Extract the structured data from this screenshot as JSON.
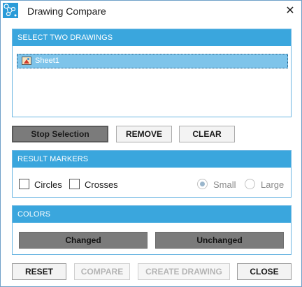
{
  "window": {
    "title": "Drawing Compare",
    "close_symbol": "✕",
    "icon": "app-network-icon"
  },
  "drawings": {
    "header": "SELECT TWO DRAWINGS",
    "items": [
      {
        "label": "Sheet1",
        "icon": "sheet-icon",
        "selected": true
      }
    ]
  },
  "list_actions": {
    "stop_selection": "Stop Selection",
    "remove": "REMOVE",
    "clear": "CLEAR"
  },
  "result_markers": {
    "header": "RESULT MARKERS",
    "circles_label": "Circles",
    "crosses_label": "Crosses",
    "small_label": "Small",
    "large_label": "Large",
    "circles_checked": false,
    "crosses_checked": false,
    "selected_size": "Small"
  },
  "colors": {
    "header": "COLORS",
    "changed_label": "Changed",
    "unchanged_label": "Unchanged",
    "changed_color": "#7b7b7b",
    "unchanged_color": "#7b7b7b"
  },
  "footer": {
    "reset": "RESET",
    "compare": "COMPARE",
    "create_drawing": "CREATE DRAWING",
    "close": "CLOSE"
  },
  "theme": {
    "accent": "#3aa6dd",
    "selection": "#7ec4ea"
  }
}
